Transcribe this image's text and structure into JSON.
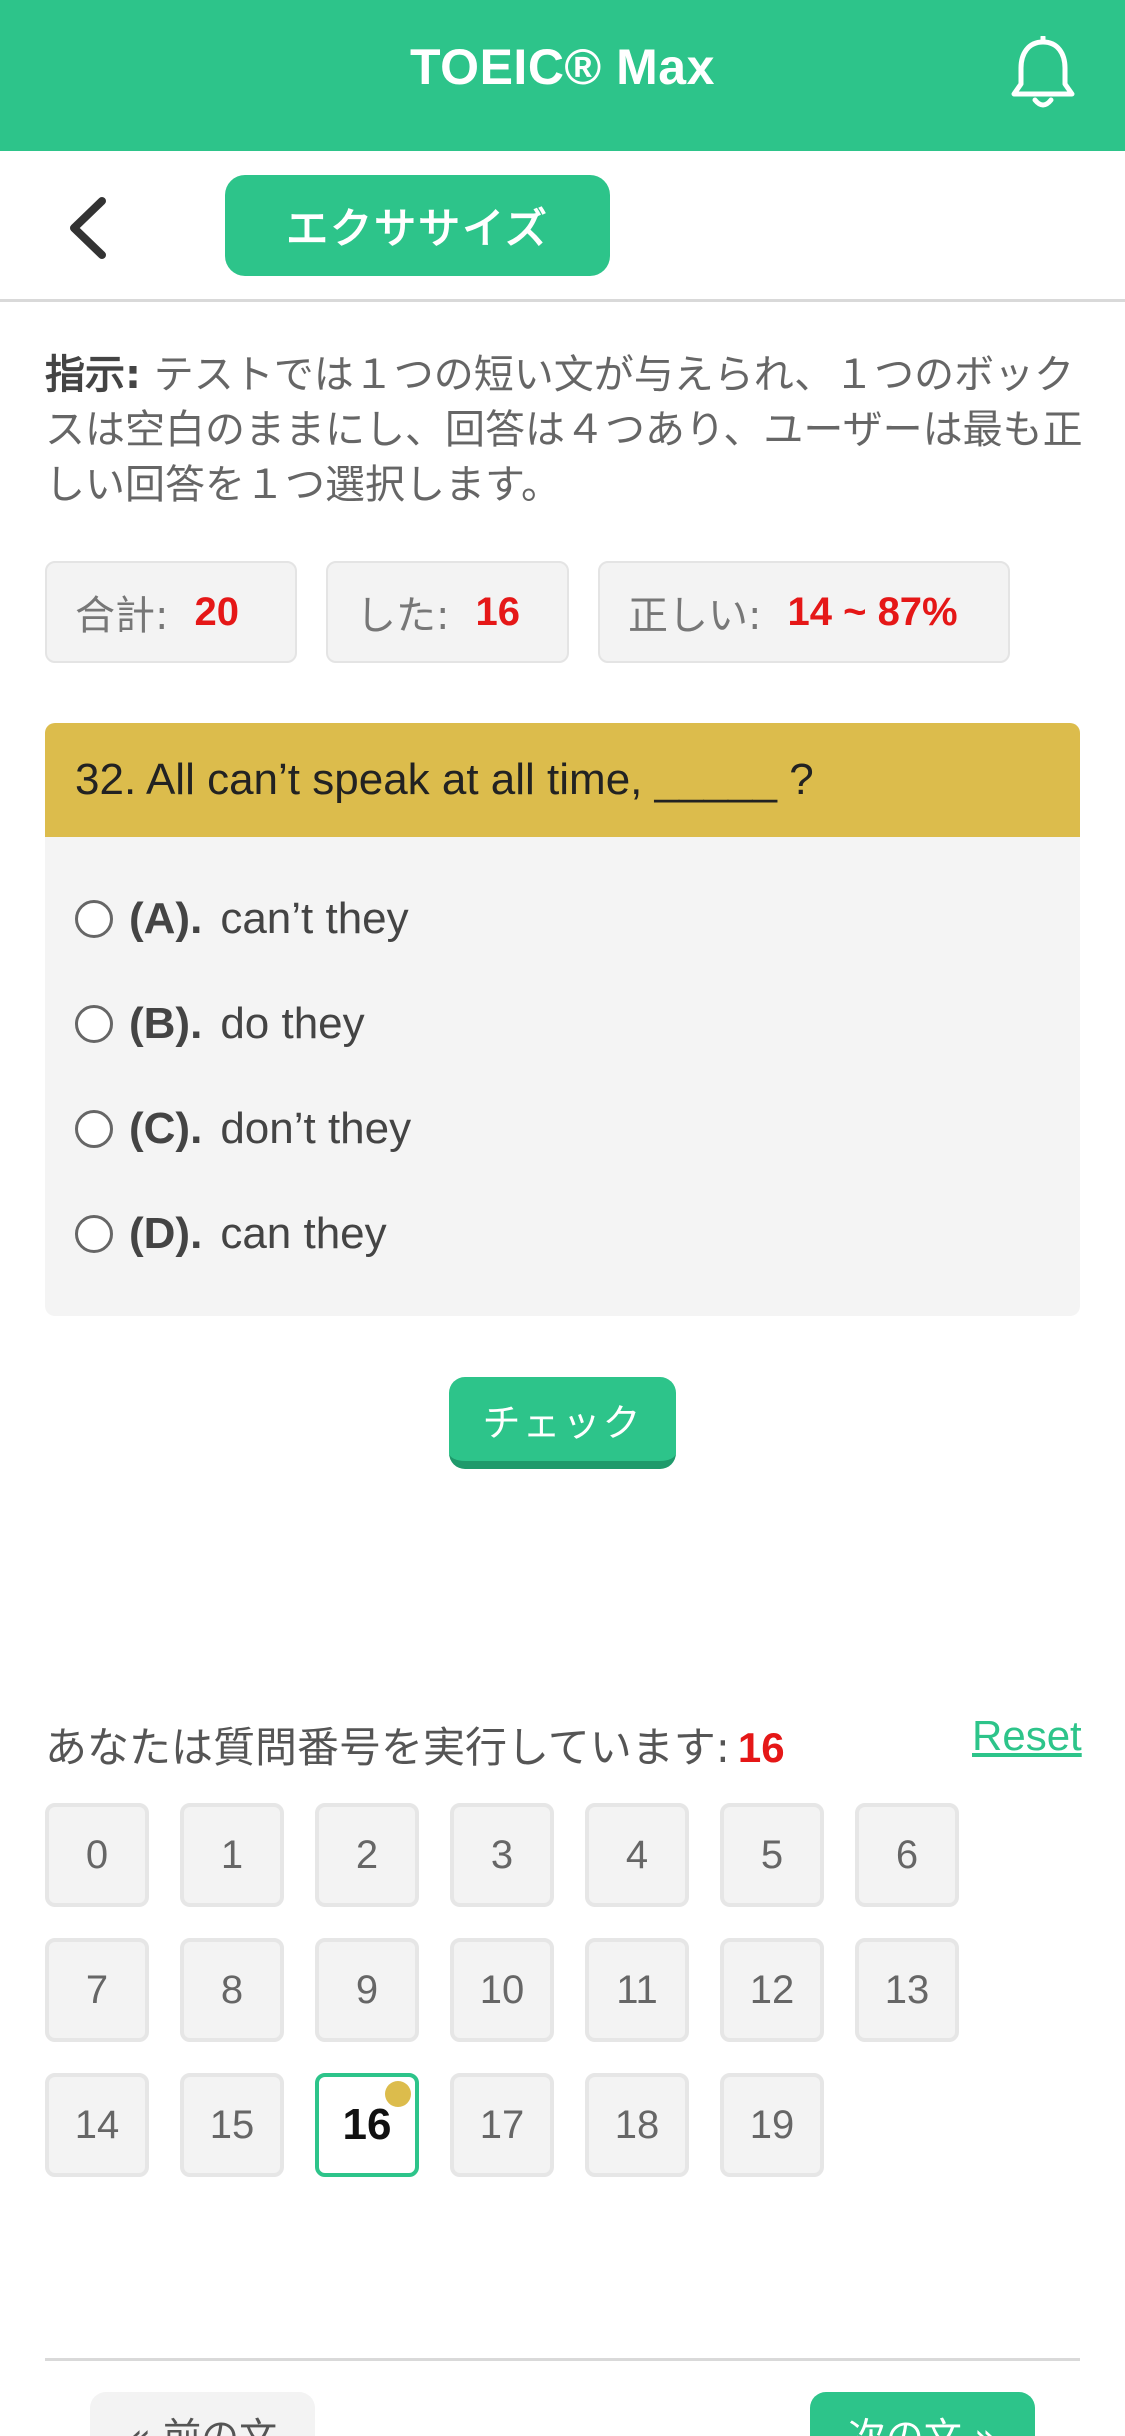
{
  "header": {
    "title": "TOEIC® Max",
    "bell_icon": "bell-icon"
  },
  "subheader": {
    "back_icon": "chevron-left-icon",
    "tab_label": "エクササイズ"
  },
  "instruction": {
    "label": "指示:",
    "text": "テストでは１つの短い文が与えられ、１つのボックスは空白のままにし、回答は４つあり、ユーザーは最も正しい回答を１つ選択します。"
  },
  "stats": {
    "total_label": "合計:",
    "total_value": "20",
    "done_label": "した:",
    "done_value": "16",
    "correct_label": "正しい:",
    "correct_value": "14 ~ 87%"
  },
  "question": {
    "text": "32. All can’t speak at all time, _____ ?",
    "options": [
      {
        "letter": "(A).",
        "text": "can’t they"
      },
      {
        "letter": "(B).",
        "text": "do they"
      },
      {
        "letter": "(C).",
        "text": "don’t they"
      },
      {
        "letter": "(D).",
        "text": "can they"
      }
    ]
  },
  "check_button": "チェック",
  "progress": {
    "running_label": "あなたは質問番号を実行しています:",
    "current": "16",
    "reset_label": "Reset",
    "numbers": [
      "0",
      "1",
      "2",
      "3",
      "4",
      "5",
      "6",
      "7",
      "8",
      "9",
      "10",
      "11",
      "12",
      "13",
      "14",
      "15",
      "16",
      "17",
      "18",
      "19"
    ]
  },
  "nav": {
    "prev_label": "« 前の文",
    "next_label": "次の文 »"
  },
  "colors": {
    "accent": "#2dc48a",
    "question_header": "#dcbc4c",
    "highlight_red": "#e51717"
  }
}
